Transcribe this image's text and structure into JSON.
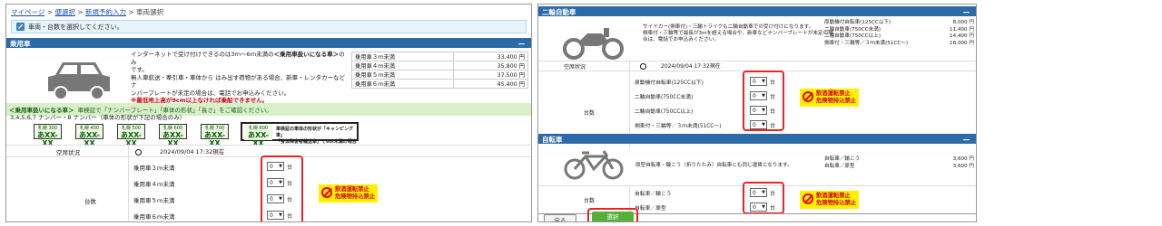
{
  "breadcrumb": {
    "items": [
      "マイページ",
      "便選択",
      "新規予約入力",
      "車両選択"
    ],
    "sep": ">"
  },
  "info_message": "車両・台数を選択してください。",
  "car": {
    "header": "乗用車",
    "collapse": "－",
    "desc_lines": [
      [
        "インターネットで受け付けできるのは3ｍ～6ｍ未満の",
        "＜乗用車扱いになる車＞",
        "のみ"
      ],
      [
        "です。"
      ],
      [
        "無人車航送・牽引車・車体から はみ出す荷物がある場合、新車・レンタカーなどナ"
      ],
      [
        "ンバープレートが未定の場合は、電話でお申込みください。"
      ],
      [
        "※最低地上高が9cm以上なければ乗船できません。"
      ]
    ],
    "prices": [
      {
        "label": "乗用車３ｍ未満",
        "price": "33,400 円"
      },
      {
        "label": "乗用車４ｍ未満",
        "price": "35,800 円"
      },
      {
        "label": "乗用車５ｍ未満",
        "price": "37,500 円"
      },
      {
        "label": "乗用車６ｍ未満",
        "price": "45,400 円"
      }
    ],
    "green_label": "＜乗用車扱いになる車＞",
    "green_text": "車検証で「ナンバープレート」「車体の形状」「長さ」をご確認ください。",
    "plate_note": "3,4,5,6,7 ナンバー・8 ナンバー（車体の形状が下記の場合のみ）",
    "plates": [
      {
        "top": "札幌 300",
        "bottom": "あXX-XX"
      },
      {
        "top": "札幌 400",
        "bottom": "あXX-XX"
      },
      {
        "top": "札幌 500",
        "bottom": "あXX-XX"
      },
      {
        "top": "札幌 600",
        "bottom": "あXX-XX"
      },
      {
        "top": "札幌 700",
        "bottom": "あXX-XX"
      }
    ],
    "special_plate": {
      "top": "札幌 800",
      "bottom": "あXX-XX",
      "note1": "車検証の車体の形状が「キャンピング車」",
      "note2": "「身体障害者輸送車」で6m未満の場合"
    },
    "vacancy_label": "空席状況",
    "vacancy_time": "2024/09/04 17:32現在",
    "count_label": "台数",
    "rows": [
      {
        "label": "乗用車３ｍ未満",
        "value": "0",
        "unit": "台"
      },
      {
        "label": "乗用車４ｍ未満",
        "value": "0",
        "unit": "台"
      },
      {
        "label": "乗用車５ｍ未満",
        "value": "0",
        "unit": "台"
      },
      {
        "label": "乗用車６ｍ未満",
        "value": "0",
        "unit": "台"
      }
    ],
    "warning": [
      "飲酒運転禁止",
      "危険物持込禁止"
    ]
  },
  "moto": {
    "header": "二輪自動車",
    "collapse": "－",
    "desc_lines": [
      "サイドカー(側車付)・三輪トライクも二輪自動車での受け付けになります。",
      "側車付・三輪等で最長が3mを超える場合や、新車などナンバープレートが未定の場",
      "合は、電話でお申込みください。"
    ],
    "prices": [
      {
        "label": "原動機付自転車(125CC以下)",
        "price": "8,000 円"
      },
      {
        "label": "二輪自動車(750CC未満)",
        "price": "11,400 円"
      },
      {
        "label": "二輪自動車(750CC以上)",
        "price": "14,400 円"
      },
      {
        "label": "側車付・三輪等／３ｍ未満(51CC～)",
        "price": "18,000 円"
      }
    ],
    "vacancy_label": "空席状況",
    "vacancy_time": "2024/09/04 17:32現在",
    "count_label": "台数",
    "rows": [
      {
        "label": "原動機付自転車(125CC以下)",
        "value": "0",
        "unit": "台"
      },
      {
        "label": "二輪自動車(750CC未満)",
        "value": "0",
        "unit": "台"
      },
      {
        "label": "二輪自動車(750CC以上)",
        "value": "0",
        "unit": "台"
      },
      {
        "label": "側車付・三輪等／３ｍ未満(51CC～)",
        "value": "0",
        "unit": "台"
      }
    ],
    "warning": [
      "飲酒運転禁止",
      "危険物持込禁止"
    ]
  },
  "bike": {
    "header": "自転車",
    "collapse": "－",
    "desc": "原型自転車・輪こう（折りたたみ）自転車とも同じ運賃となります。",
    "prices": [
      {
        "label": "自転車／輪こう",
        "price": "3,600 円"
      },
      {
        "label": "自転車／原型",
        "price": "3,600 円"
      }
    ],
    "count_label": "台数",
    "rows": [
      {
        "label": "自転車／輪こう",
        "value": "0",
        "unit": "台"
      },
      {
        "label": "自転車／原型",
        "value": "0",
        "unit": "台"
      }
    ],
    "warning": [
      "飲酒運転禁止",
      "危険物持込禁止"
    ]
  },
  "buttons": {
    "back": "戻る",
    "select": "選択"
  },
  "colors": {
    "header_blue": "#2d6aa8",
    "select_green": "#55b03a",
    "highlight_red": "#e22222",
    "warning_yellow": "#fff100"
  }
}
